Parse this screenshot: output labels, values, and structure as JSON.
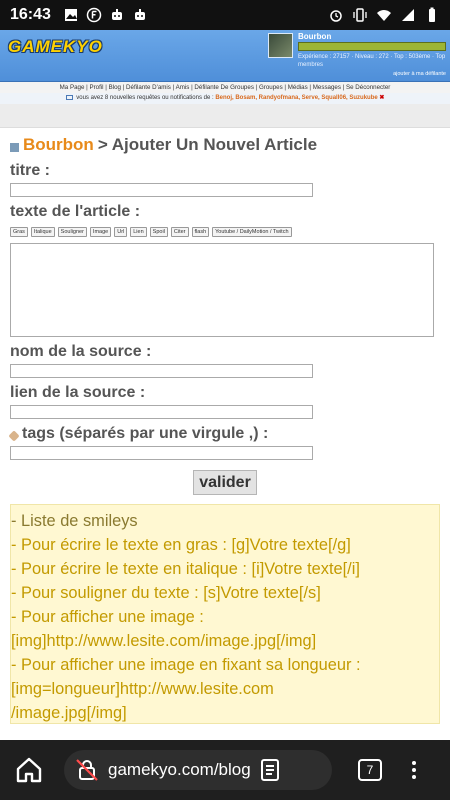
{
  "status_bar": {
    "time": "16:43",
    "icons": [
      "image-icon",
      "f-badge-icon",
      "robot-icon",
      "robot-icon",
      "alarm-icon",
      "vibrate-icon",
      "wifi-icon",
      "signal-icon",
      "battery-icon"
    ]
  },
  "site": {
    "logo_text": "GAMEKYO",
    "user": {
      "name": "Bourbon",
      "xp_text": "Expérience : 27157 · Niveau : 272 · Top : 503ème · Top membres",
      "add_fav": "ajouter à ma défilante"
    },
    "nav": [
      "Ma Page",
      "Profil",
      "Blog",
      "Défilante D'amis",
      "Amis",
      "Défilante De Groupes",
      "Groupes",
      "Médias",
      "Messages",
      "Se Déconnecter"
    ],
    "nav_sep": " | ",
    "notification": {
      "prefix": "vous avez 8 nouvelles requêtes ou notifications de :",
      "names": "Benoj, Bosam, Randyofmana, Serve, Squall06, Suzukube",
      "close": "✖"
    }
  },
  "form": {
    "author": "Bourbon",
    "separator": ">",
    "heading": "Ajouter Un Nouvel Article",
    "title_label": "titre :",
    "body_label": "texte de l'article :",
    "format_buttons": [
      "Gras",
      "Italique",
      "Souligner",
      "Image",
      "Url",
      "Lien",
      "Spoil",
      "Citer",
      "flash",
      "Youtube / DailyMotion / Twitch"
    ],
    "source_name_label": "nom de la source :",
    "source_link_label": "lien de la source :",
    "tags_label": "tags (séparés par une virgule ,) :",
    "submit_label": "valider"
  },
  "help": [
    "- Liste de smileys",
    "- Pour écrire le texte en gras : [g]Votre texte[/g]",
    "- Pour écrire le texte en italique : [i]Votre texte[/i]",
    "- Pour souligner du texte : [s]Votre texte[/s]",
    "- Pour afficher une image :",
    "[img]http://www.lesite.com/image.jpg[/img]",
    "- Pour afficher une image en fixant sa longueur :",
    "[img=longueur]http://www.lesite.com",
    "/image.jpg[/img]"
  ],
  "browser": {
    "url": "gamekyo.com/blog",
    "tab_count": "7",
    "icons": [
      "home-icon",
      "insecure-lock-icon",
      "reader-icon",
      "tabs-icon",
      "more-icon"
    ]
  }
}
